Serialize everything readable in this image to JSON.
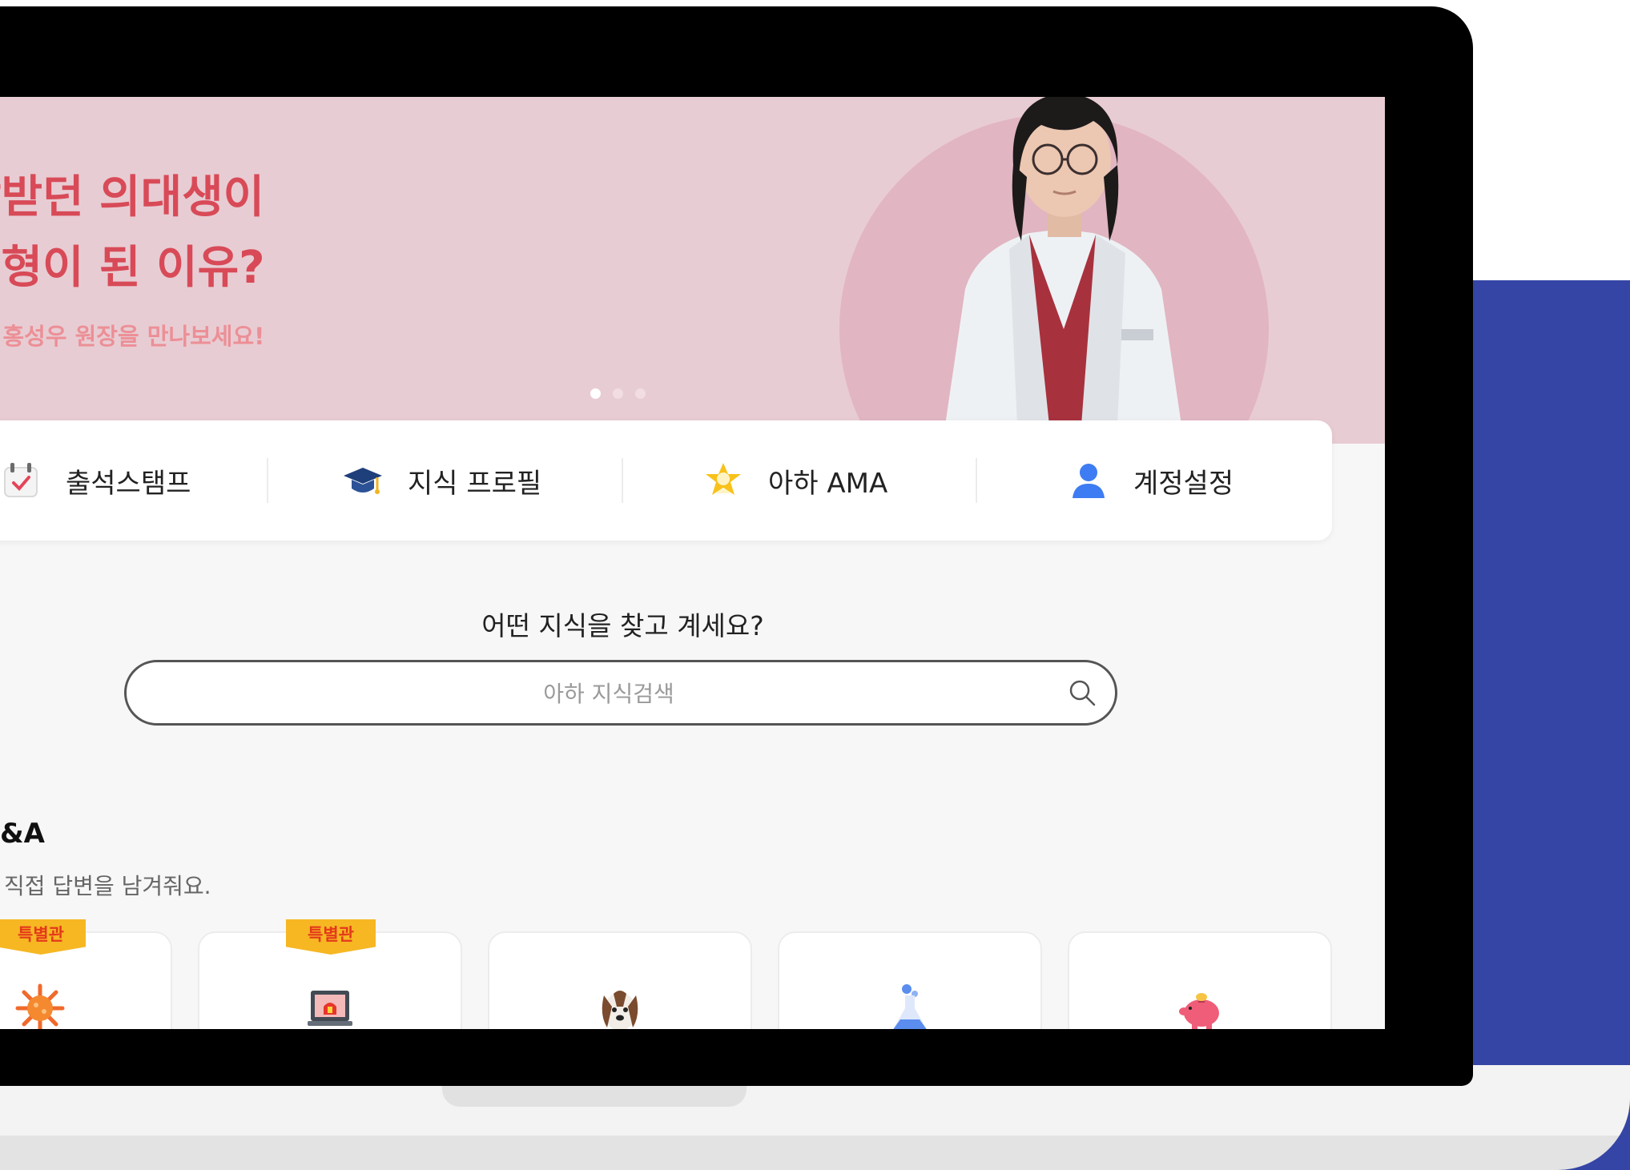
{
  "banner": {
    "headline_line1": "랑받던 의대생이",
    "headline_line2": "투형이 된 이유?",
    "subtext": "에서 홍성우 원장을 만나보세요!",
    "slide_count": 3,
    "active_slide": 1
  },
  "menu": [
    {
      "label": "출석스탬프",
      "icon": "calendar-check-icon"
    },
    {
      "label": "지식 프로필",
      "icon": "graduation-cap-icon"
    },
    {
      "label": "아하 AMA",
      "icon": "star-badge-icon"
    },
    {
      "label": "계정설정",
      "icon": "user-icon"
    }
  ],
  "search": {
    "question": "어떤 지식을 찾고 계세요?",
    "placeholder": "아하 지식검색",
    "icon": "search-icon"
  },
  "qa": {
    "title": "&A",
    "subtitle": "직접 답변을 남겨줘요.",
    "badge_label": "특별관",
    "cards": [
      {
        "icon": "virus-icon",
        "badge": true
      },
      {
        "icon": "siren-laptop-icon",
        "badge": true
      },
      {
        "icon": "dog-icon",
        "badge": false
      },
      {
        "icon": "flask-icon",
        "badge": false
      },
      {
        "icon": "piggy-bank-icon",
        "badge": false
      }
    ]
  },
  "colors": {
    "banner_bg": "#e8ccd3",
    "headline": "#d84a57",
    "accent_panel": "#3545a5",
    "badge": "#f6b723"
  }
}
